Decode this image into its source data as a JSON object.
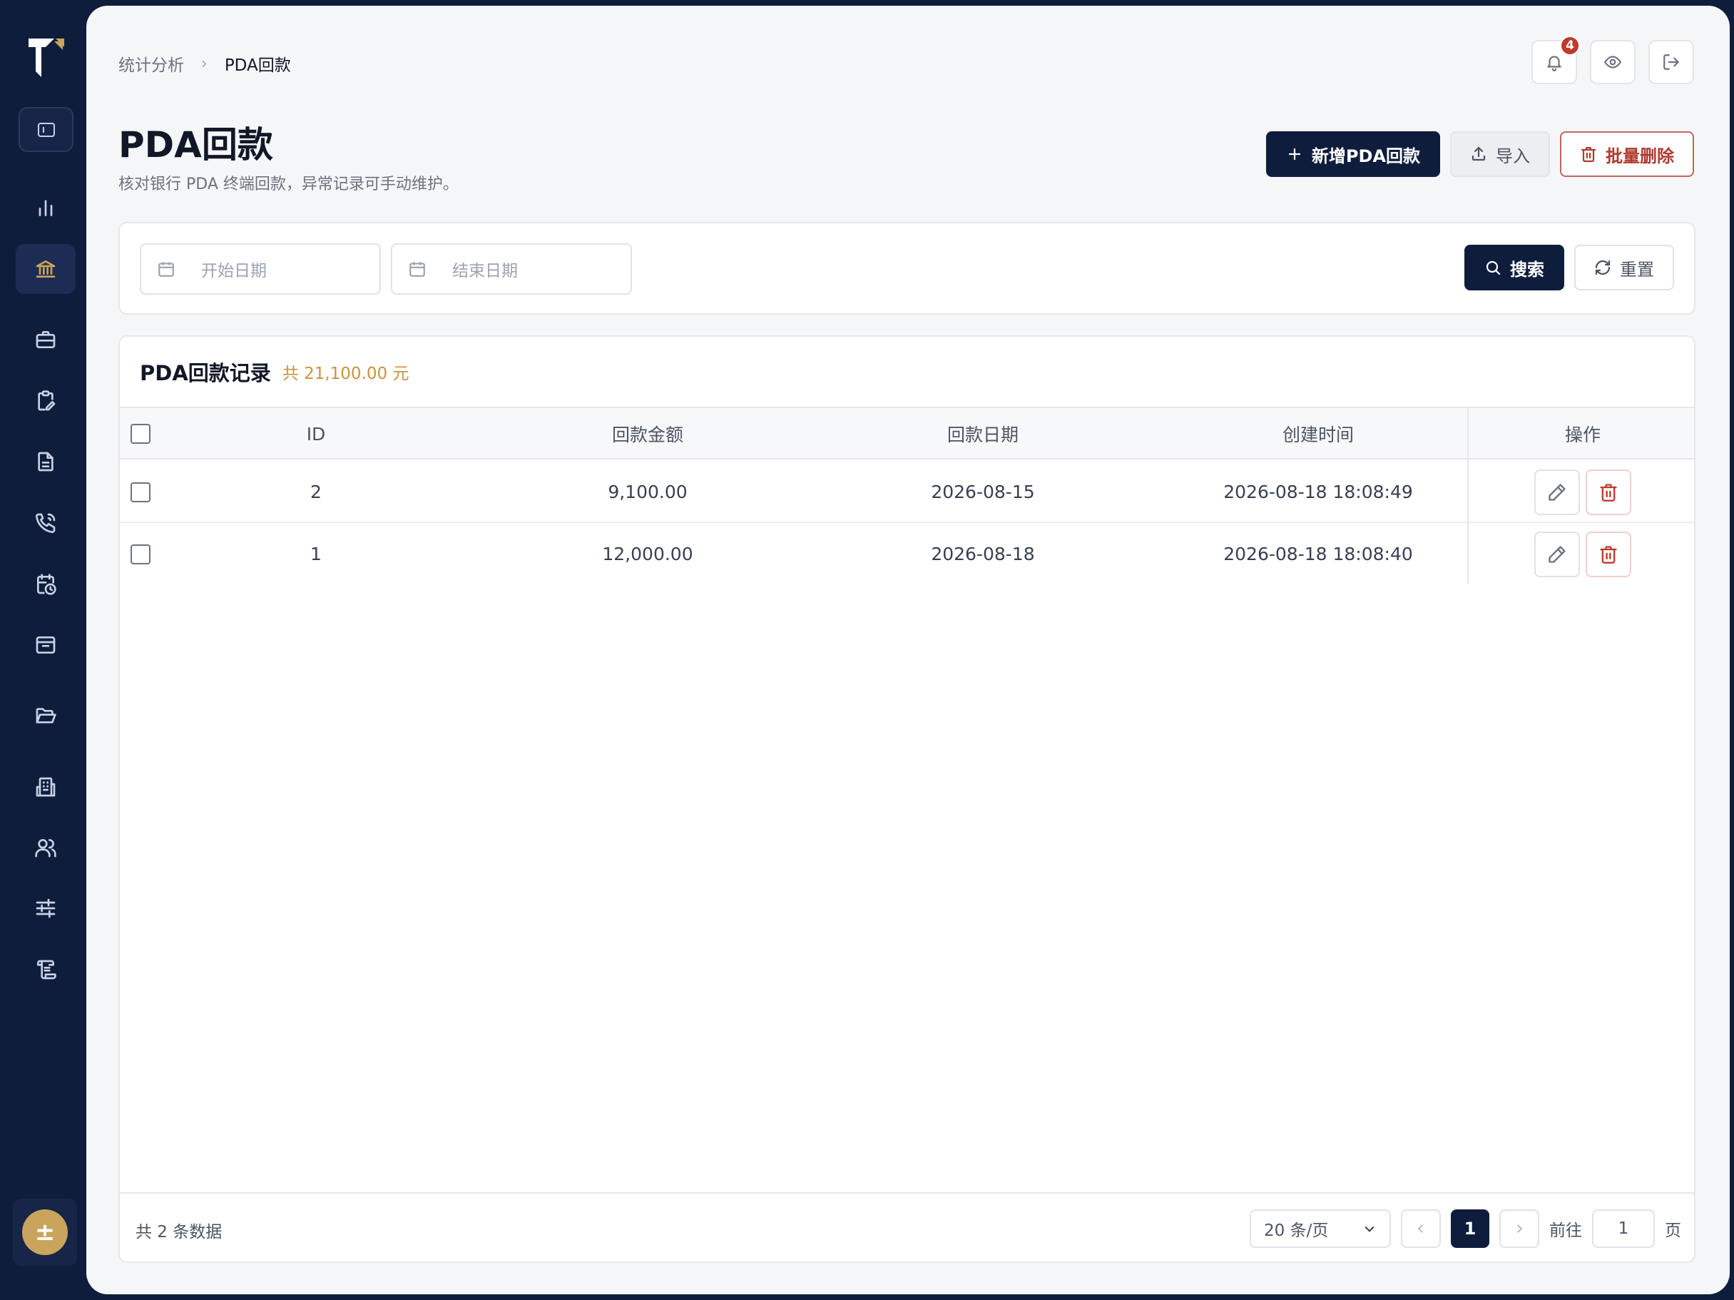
{
  "sidebar": {
    "nav_icons": [
      "bar-chart-icon",
      "bank-icon",
      "briefcase-icon",
      "clipboard-edit-icon",
      "document-icon",
      "phone-call-icon",
      "calendar-clock-icon",
      "archive-icon",
      "folder-open-icon",
      "building-icon",
      "users-icon",
      "sliders-icon",
      "scroll-icon"
    ],
    "active_item": "bank-icon",
    "avatar_text": "±",
    "accent_color": "#c9a45c",
    "background_color": "#0f1d3d"
  },
  "breadcrumb": {
    "parent": "统计分析",
    "current": "PDA回款"
  },
  "header_icons": {
    "notification_count": "4"
  },
  "page": {
    "title": "PDA回款",
    "subtitle": "核对银行 PDA 终端回款，异常记录可手动维护。"
  },
  "actions": {
    "add_label": "新增PDA回款",
    "import_label": "导入",
    "batch_delete_label": "批量删除"
  },
  "filters": {
    "start_date_placeholder": "开始日期",
    "end_date_placeholder": "结束日期",
    "search_label": "搜索",
    "reset_label": "重置"
  },
  "table": {
    "title": "PDA回款记录",
    "total_summary": "共 21,100.00 元",
    "columns": {
      "id": "ID",
      "amount": "回款金额",
      "date": "回款日期",
      "created": "创建时间",
      "ops": "操作"
    },
    "rows": [
      {
        "id": "2",
        "amount": "9,100.00",
        "date": "2026-08-15",
        "created": "2026-08-18 18:08:49"
      },
      {
        "id": "1",
        "amount": "12,000.00",
        "date": "2026-08-18",
        "created": "2026-08-18 18:08:40"
      }
    ]
  },
  "pagination": {
    "total_text": "共 2 条数据",
    "page_size": "20 条/页",
    "current_page": "1",
    "goto_label": "前往",
    "goto_value": "1",
    "page_unit": "页"
  }
}
